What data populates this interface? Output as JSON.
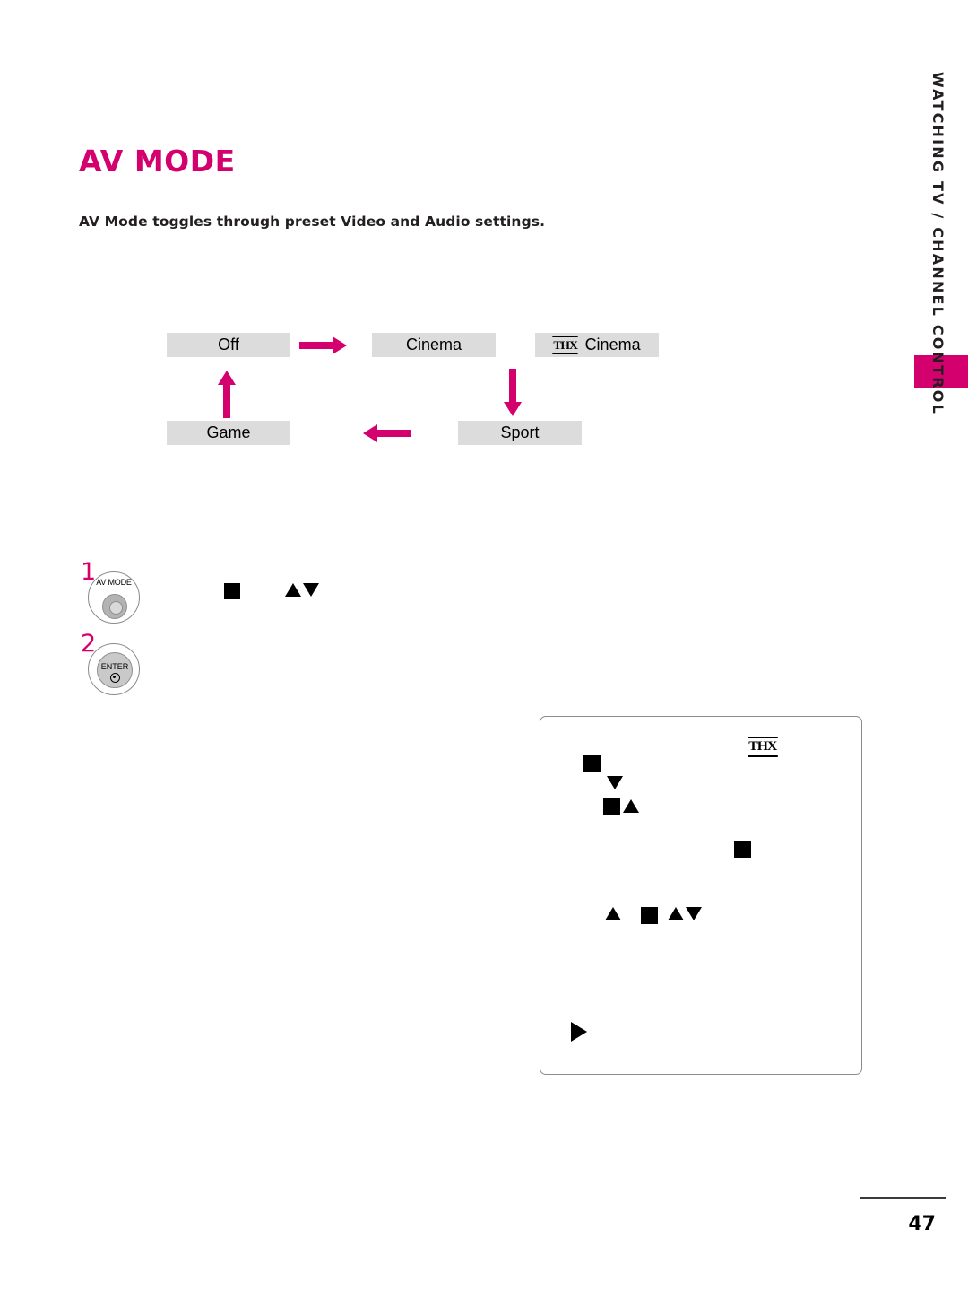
{
  "document": {
    "title": "AV MODE",
    "intro": "AV Mode toggles through preset Video and Audio settings.",
    "page_number": "47",
    "accent_color": "#D4006E",
    "box_fill_color": "#DCDCDC"
  },
  "flow_diagram": {
    "nodes": [
      {
        "id": "off",
        "label": "Off",
        "has_thx": false
      },
      {
        "id": "cinema",
        "label": "Cinema",
        "has_thx": false
      },
      {
        "id": "thx-cinema",
        "label": "Cinema",
        "has_thx": true,
        "logo": "THX"
      },
      {
        "id": "sport",
        "label": "Sport",
        "has_thx": false
      },
      {
        "id": "game",
        "label": "Game",
        "has_thx": false
      }
    ],
    "arrows": [
      {
        "id": "off-to-cinema",
        "direction": "right"
      },
      {
        "id": "cinema-to-sport",
        "direction": "down"
      },
      {
        "id": "sport-to-game",
        "direction": "left"
      },
      {
        "id": "game-to-off",
        "direction": "up"
      }
    ]
  },
  "steps": [
    {
      "number": "1",
      "button_label": "AV MODE",
      "button_type": "round-knob",
      "markers": [
        "square",
        "up-down-triangles"
      ]
    },
    {
      "number": "2",
      "button_label": "ENTER",
      "button_type": "enter-dot",
      "markers": []
    }
  ],
  "osd_panel": {
    "logo": "THX",
    "markers": [
      {
        "id": "marker-1",
        "glyph": "square"
      },
      {
        "id": "marker-2",
        "glyph": "triangle-down"
      },
      {
        "id": "marker-3",
        "glyph": "square"
      },
      {
        "id": "marker-4",
        "glyph": "triangle-up"
      },
      {
        "id": "marker-5",
        "glyph": "square"
      },
      {
        "id": "marker-6",
        "glyph": "triangle-up"
      },
      {
        "id": "marker-7",
        "glyph": "square"
      },
      {
        "id": "marker-8",
        "glyph": "triangle-up"
      },
      {
        "id": "marker-9",
        "glyph": "triangle-down"
      },
      {
        "id": "marker-10",
        "glyph": "triangle-right"
      }
    ]
  },
  "sidebar": {
    "section_label": "WATCHING TV / CHANNEL CONTROL"
  }
}
